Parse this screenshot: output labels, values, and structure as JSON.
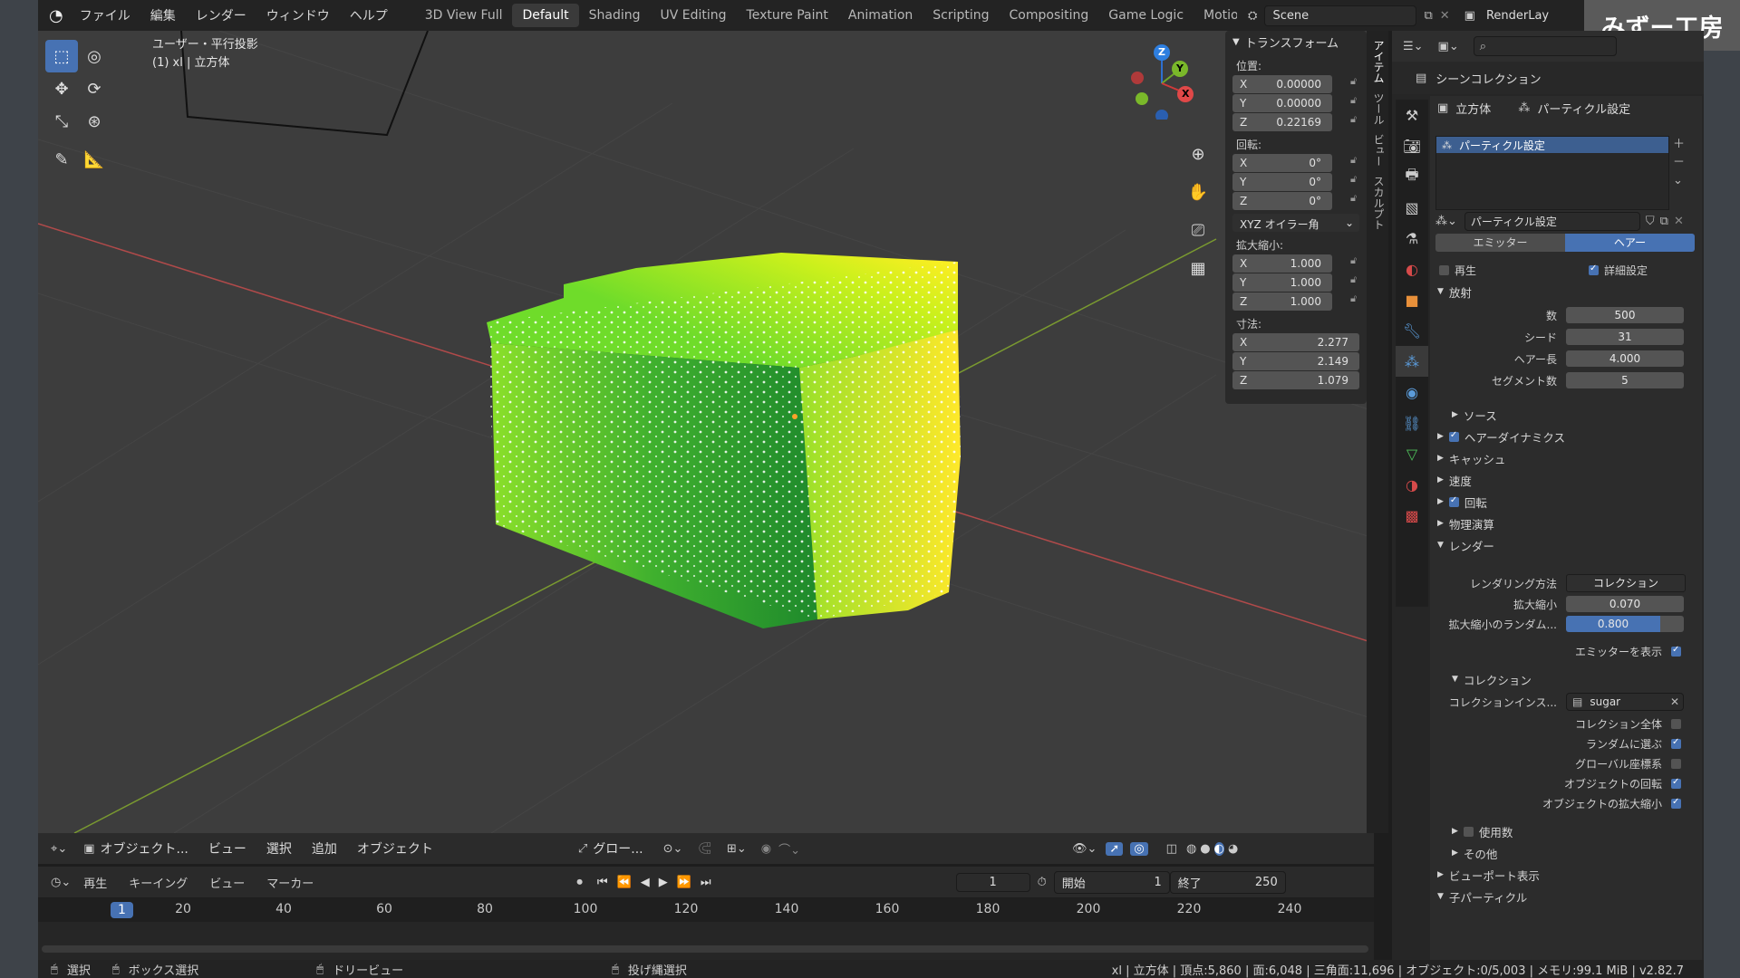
{
  "topbar": {
    "menus": [
      "ファイル",
      "編集",
      "レンダー",
      "ウィンドウ",
      "ヘルプ"
    ],
    "workspaces": [
      "3D View Full",
      "Default",
      "Shading",
      "UV Editing",
      "Texture Paint",
      "Animation",
      "Scripting",
      "Compositing",
      "Game Logic",
      "Motio"
    ],
    "active_workspace": "Default",
    "scene": "Scene",
    "render_layer": "RenderLay"
  },
  "watermark": "みずー工房",
  "viewport": {
    "overlay_line1": "ユーザー・平行投影",
    "overlay_line2": "(1) xl | 立方体",
    "gizmo": {
      "x": "X",
      "y": "Y",
      "z": "Z"
    }
  },
  "npanel": {
    "title": "トランスフォーム",
    "location_label": "位置:",
    "location": [
      {
        "ax": "X",
        "v": "0.00000"
      },
      {
        "ax": "Y",
        "v": "0.00000"
      },
      {
        "ax": "Z",
        "v": "0.22169"
      }
    ],
    "rotation_label": "回転:",
    "rotation": [
      {
        "ax": "X",
        "v": "0°"
      },
      {
        "ax": "Y",
        "v": "0°"
      },
      {
        "ax": "Z",
        "v": "0°"
      }
    ],
    "rotation_mode": "XYZ オイラー角",
    "scale_label": "拡大縮小:",
    "scale": [
      {
        "ax": "X",
        "v": "1.000"
      },
      {
        "ax": "Y",
        "v": "1.000"
      },
      {
        "ax": "Z",
        "v": "1.000"
      }
    ],
    "dimensions_label": "寸法:",
    "dimensions": [
      {
        "ax": "X",
        "v": "2.277"
      },
      {
        "ax": "Y",
        "v": "2.149"
      },
      {
        "ax": "Z",
        "v": "1.079"
      }
    ]
  },
  "sidetabs": [
    "アイテム",
    "ツール",
    "ビュー",
    "スカルプト"
  ],
  "outliner": {
    "title": "シーンコレクション"
  },
  "props": {
    "breadcrumb_object": "立方体",
    "breadcrumb_section": "パーティクル設定",
    "system_name": "パーティクル設定",
    "settings_name": "パーティクル設定",
    "tab_emitter": "エミッター",
    "tab_hair": "ヘアー",
    "regrow": "再生",
    "advanced": "詳細設定",
    "emission": "放射",
    "fields": [
      {
        "label": "数",
        "value": "500"
      },
      {
        "label": "シード",
        "value": "31"
      },
      {
        "label": "ヘアー長",
        "value": "4.000"
      },
      {
        "label": "セグメント数",
        "value": "5"
      }
    ],
    "sections": [
      "ソース",
      "ヘアーダイナミクス",
      "キャッシュ",
      "速度",
      "回転",
      "物理演算",
      "レンダー"
    ],
    "render_as_label": "レンダリング方法",
    "render_as": "コレクション",
    "scale_label": "拡大縮小",
    "scale_value": "0.070",
    "scale_random_label": "拡大縮小のランダム...",
    "scale_random_value": "0.800",
    "show_emitter": "エミッターを表示",
    "collection_section": "コレクション",
    "instance_collection_label": "コレクションインス...",
    "instance_collection": "sugar",
    "whole_collection": "コレクション全体",
    "pick_random": "ランダムに選ぶ",
    "global_coords": "グローバル座標系",
    "object_rotation": "オブジェクトの回転",
    "object_scale": "オブジェクトの拡大縮小",
    "use_count": "使用数",
    "other": "その他",
    "viewport_display": "ビューポート表示",
    "children": "子パーティクル"
  },
  "vp_header": {
    "mode": "オブジェクト...",
    "menus": [
      "ビュー",
      "選択",
      "追加",
      "オブジェクト"
    ],
    "transform_orientation": "グロー..."
  },
  "timeline": {
    "menus": [
      "再生",
      "キーイング",
      "ビュー",
      "マーカー"
    ],
    "current_frame": "1",
    "start_label": "開始",
    "start": "1",
    "end_label": "終了",
    "end": "250",
    "ruler": [
      "1",
      "20",
      "40",
      "60",
      "80",
      "100",
      "120",
      "140",
      "160",
      "180",
      "200",
      "220",
      "240"
    ]
  },
  "statusbar": {
    "select": "選択",
    "box_select": "ボックス選択",
    "dolly": "ドリービュー",
    "lasso": "投げ縄選択",
    "stats": "xl | 立方体 | 頂点:5,860 | 面:6,048 | 三角面:11,696 | オブジェクト:0/5,003 | メモリ:99.1 MiB | v2.82.7"
  }
}
